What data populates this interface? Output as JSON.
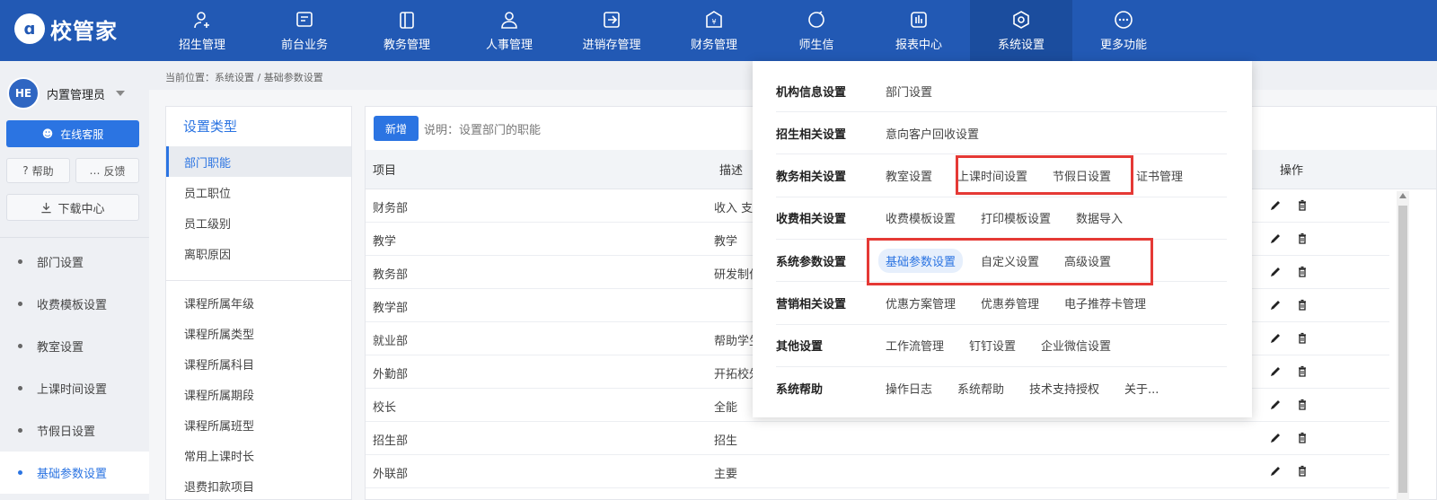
{
  "brand": {
    "logo_text": "校管家"
  },
  "nav": [
    {
      "label": "招生管理",
      "icon": "person-add-icon"
    },
    {
      "label": "前台业务",
      "icon": "desk-icon"
    },
    {
      "label": "教务管理",
      "icon": "book-icon"
    },
    {
      "label": "人事管理",
      "icon": "person-icon"
    },
    {
      "label": "进销存管理",
      "icon": "inout-icon"
    },
    {
      "label": "财务管理",
      "icon": "yuan-icon"
    },
    {
      "label": "师生信",
      "icon": "chat-icon"
    },
    {
      "label": "报表中心",
      "icon": "report-icon"
    },
    {
      "label": "系统设置",
      "icon": "settings-icon",
      "active": true
    },
    {
      "label": "更多功能",
      "icon": "more-icon"
    }
  ],
  "user": {
    "avatar_text": "HE",
    "name": "内置管理员"
  },
  "sidebar": {
    "online_service": "在线客服",
    "help": "帮助",
    "feedback": "反馈",
    "download_center": "下载中心",
    "items": [
      {
        "label": "部门设置"
      },
      {
        "label": "收费模板设置"
      },
      {
        "label": "教室设置"
      },
      {
        "label": "上课时间设置"
      },
      {
        "label": "节假日设置"
      },
      {
        "label": "基础参数设置",
        "active": true
      }
    ]
  },
  "breadcrumb": "当前位置：系统设置 / 基础参数设置",
  "settings_type": {
    "title": "设置类型",
    "group1": [
      "部门职能",
      "员工职位",
      "员工级别",
      "离职原因"
    ],
    "group2": [
      "课程所属年级",
      "课程所属类型",
      "课程所属科目",
      "课程所属期段",
      "课程所属班型",
      "常用上课时长",
      "退费扣款项目"
    ]
  },
  "toolbar": {
    "add_label": "新增",
    "hint": "说明：设置部门的职能"
  },
  "table": {
    "headers": {
      "item": "项目",
      "desc": "描述",
      "ops": "操作"
    },
    "rows": [
      {
        "item": "财务部",
        "desc": "收入 支"
      },
      {
        "item": "教学",
        "desc": "教学"
      },
      {
        "item": "教务部",
        "desc": "研发制作"
      },
      {
        "item": "教学部",
        "desc": ""
      },
      {
        "item": "就业部",
        "desc": "帮助学生"
      },
      {
        "item": "外勤部",
        "desc": "开拓校外"
      },
      {
        "item": "校长",
        "desc": "全能"
      },
      {
        "item": "招生部",
        "desc": "招生"
      },
      {
        "item": "外联部",
        "desc": "主要"
      }
    ]
  },
  "dropdown": [
    {
      "category": "机构信息设置",
      "links": [
        "部门设置"
      ]
    },
    {
      "category": "招生相关设置",
      "links": [
        "意向客户回收设置"
      ]
    },
    {
      "category": "教务相关设置",
      "links": [
        "教室设置",
        "上课时间设置",
        "节假日设置",
        "证书管理"
      ]
    },
    {
      "category": "收费相关设置",
      "links": [
        "收费模板设置",
        "打印模板设置",
        "数据导入"
      ]
    },
    {
      "category": "系统参数设置",
      "links": [
        "基础参数设置",
        "自定义设置",
        "高级设置"
      ],
      "active_index": 0
    },
    {
      "category": "营销相关设置",
      "links": [
        "优惠方案管理",
        "优惠券管理",
        "电子推荐卡管理"
      ]
    },
    {
      "category": "其他设置",
      "links": [
        "工作流管理",
        "钉钉设置",
        "企业微信设置"
      ]
    },
    {
      "category": "系统帮助",
      "links": [
        "操作日志",
        "系统帮助",
        "技术支持授权",
        "关于..."
      ]
    }
  ],
  "colors": {
    "primary": "#2259b4",
    "accent": "#2b74e2",
    "highlight_box": "#e53935"
  }
}
